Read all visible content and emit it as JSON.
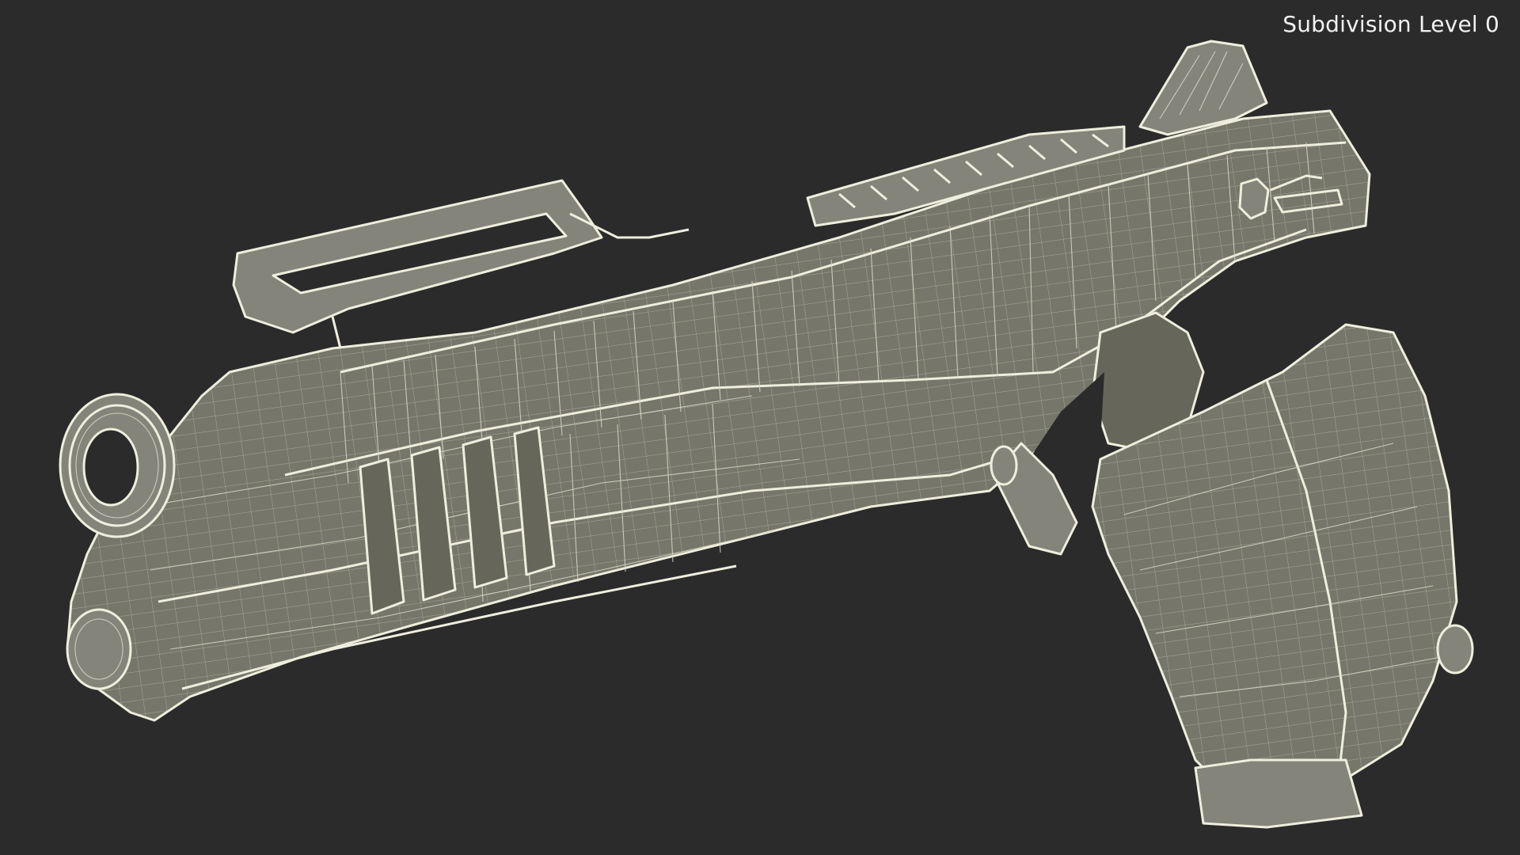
{
  "viewport": {
    "label": "Subdivision Level 0",
    "background_color": "#2b2b2b",
    "model_color": "#76766a",
    "wire_color": "#efeedd"
  },
  "model": {
    "subject": "pistol-wireframe"
  }
}
